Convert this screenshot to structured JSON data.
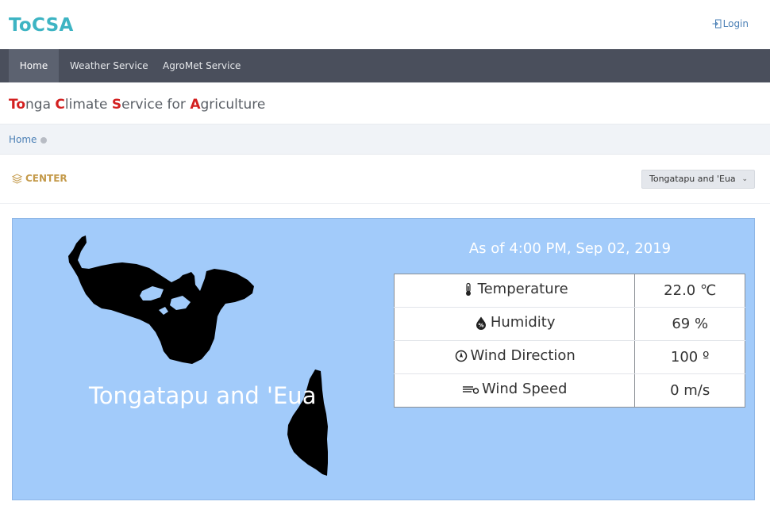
{
  "header": {
    "brand": "ToCSA",
    "login_label": "Login"
  },
  "nav": {
    "items": [
      {
        "label": "Home",
        "active": true
      },
      {
        "label": "Weather Service",
        "active": false
      },
      {
        "label": "AgroMet Service",
        "active": false
      }
    ]
  },
  "subtitle": {
    "words": [
      {
        "cap": "To",
        "rest": "nga "
      },
      {
        "cap": "C",
        "rest": "limate "
      },
      {
        "cap": "S",
        "rest": "ervice for "
      },
      {
        "cap": "A",
        "rest": "griculture"
      }
    ]
  },
  "breadcrumb": {
    "home": "Home"
  },
  "center": {
    "label": "CENTER",
    "icon": "layers-icon",
    "select_value": "Tongatapu and 'Eua"
  },
  "map": {
    "region_label": "Tongatapu and 'Eua",
    "as_of": "As of 4:00 PM, Sep 02, 2019"
  },
  "weather": {
    "rows": [
      {
        "icon": "thermometer-icon",
        "label": "Temperature",
        "value": "22.0 ℃"
      },
      {
        "icon": "humidity-icon",
        "label": "Humidity",
        "value": "69 %"
      },
      {
        "icon": "compass-icon",
        "label": "Wind Direction",
        "value": "100 º"
      },
      {
        "icon": "wind-icon",
        "label": "Wind Speed",
        "value": "0 m/s"
      }
    ]
  },
  "colors": {
    "brand": "#3db4c3",
    "navbar": "#4a4f5c",
    "map_sea": "#a2cbfa",
    "accent_red": "#d32020",
    "center_gold": "#c49a4a"
  }
}
